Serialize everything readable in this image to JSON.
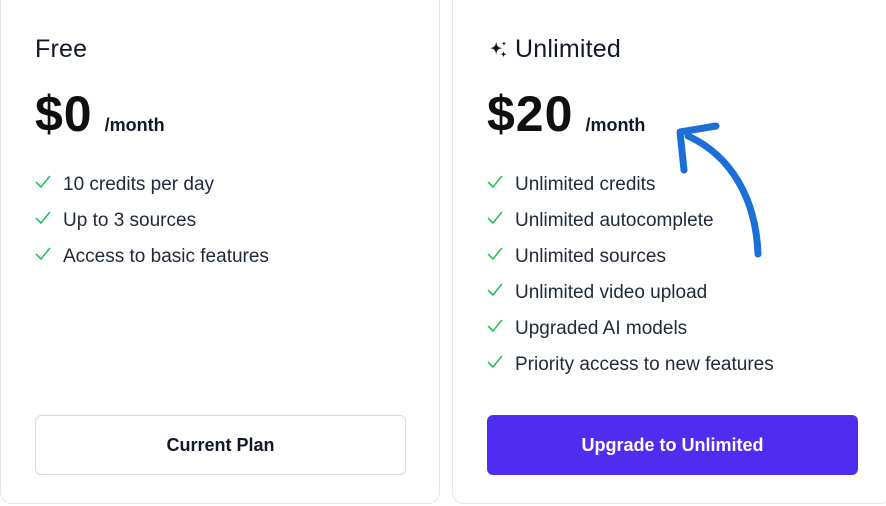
{
  "colors": {
    "check": "#22c55e",
    "accent": "#4f2cf0",
    "arrow": "#1d6fd8",
    "border": "#e5e7eb"
  },
  "plans": [
    {
      "title": "Free",
      "price": "$0",
      "period": "/month",
      "features": [
        "10 credits per day",
        "Up to 3 sources",
        "Access to basic features"
      ],
      "button_label": "Current Plan"
    },
    {
      "title": "Unlimited",
      "title_icon": "sparkle-icon",
      "price": "$20",
      "period": "/month",
      "features": [
        "Unlimited credits",
        "Unlimited autocomplete",
        "Unlimited sources",
        "Unlimited video upload",
        "Upgraded AI models",
        "Priority access to new features"
      ],
      "button_label": "Upgrade to Unlimited"
    }
  ],
  "annotation": {
    "icon": "curved-arrow-icon"
  }
}
